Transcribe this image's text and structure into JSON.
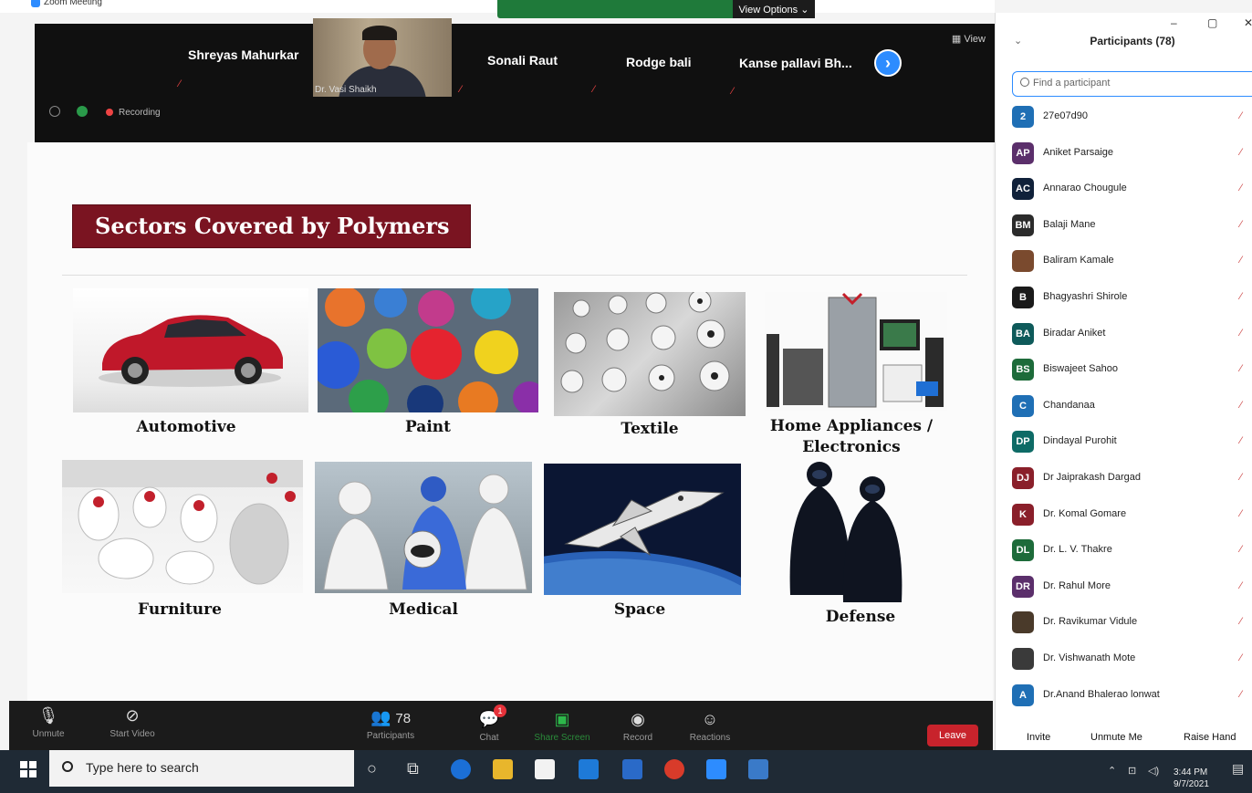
{
  "window": {
    "title": "Zoom Meeting"
  },
  "share_bar": {
    "view_options": "View Options ⌄"
  },
  "video_strip": {
    "participants": [
      "Shreyas Mahurkar",
      "Sonali Raut",
      "Rodge bali",
      "Kanse pallavi Bh..."
    ],
    "active_speaker": "Dr. Vasi Shaikh",
    "recording_label": "Recording",
    "view_label": "View",
    "next_arrow": "›"
  },
  "slide": {
    "title": "Sectors Covered by Polymers",
    "sectors": [
      {
        "label": "Automotive"
      },
      {
        "label": "Paint"
      },
      {
        "label": "Textile"
      },
      {
        "label_line1": "Home Appliances /",
        "label_line2": "Electronics"
      },
      {
        "label": "Furniture"
      },
      {
        "label": "Medical"
      },
      {
        "label": "Space"
      },
      {
        "label": "Defense"
      }
    ]
  },
  "panel": {
    "title": "Participants (78)",
    "collapse": "⌄",
    "search_placeholder": "Find a participant",
    "participants": [
      {
        "initials": "2",
        "name": "27e07d90",
        "color": "#1f6fb5"
      },
      {
        "initials": "AP",
        "name": "Aniket Parsaige",
        "color": "#5b2f6b"
      },
      {
        "initials": "AC",
        "name": "Annarao Chougule",
        "color": "#10213a"
      },
      {
        "initials": "BM",
        "name": "Balaji Mane",
        "color": "#2b2b2b"
      },
      {
        "initials": "",
        "name": "Baliram Kamale",
        "color": "#7a4a2e"
      },
      {
        "initials": "B",
        "name": "Bhagyashri Shirole",
        "color": "#1a1a1a"
      },
      {
        "initials": "BA",
        "name": "Biradar Aniket",
        "color": "#0e5a5a"
      },
      {
        "initials": "BS",
        "name": "Biswajeet Sahoo",
        "color": "#1d6b3a"
      },
      {
        "initials": "C",
        "name": "Chandanaa",
        "color": "#1f6fb5"
      },
      {
        "initials": "DP",
        "name": "Dindayal Purohit",
        "color": "#0e6b66"
      },
      {
        "initials": "DJ",
        "name": "Dr Jaiprakash Dargad",
        "color": "#8a1f2a"
      },
      {
        "initials": "K",
        "name": "Dr. Komal Gomare",
        "color": "#8a1f2a"
      },
      {
        "initials": "DL",
        "name": "Dr. L. V. Thakre",
        "color": "#1d6b3a"
      },
      {
        "initials": "DR",
        "name": "Dr. Rahul More",
        "color": "#5b2f6b"
      },
      {
        "initials": "",
        "name": "Dr. Ravikumar Vidule",
        "color": "#4a3a2a"
      },
      {
        "initials": "",
        "name": "Dr. Vishwanath Mote",
        "color": "#3a3a3a"
      },
      {
        "initials": "A",
        "name": "Dr.Anand Bhalerao lonwat",
        "color": "#1f6fb5"
      }
    ],
    "footer": {
      "invite": "Invite",
      "unmute": "Unmute Me",
      "raise_hand": "Raise Hand"
    }
  },
  "toolbar": {
    "unmute": "Unmute",
    "start_video": "Start Video",
    "participants": "Participants",
    "participants_count": "78",
    "chat": "Chat",
    "chat_badge": "1",
    "share_screen": "Share Screen",
    "record": "Record",
    "reactions": "Reactions",
    "leave": "Leave"
  },
  "taskbar": {
    "search_placeholder": "Type here to search",
    "time": "3:44 PM",
    "date": "9/7/2021"
  },
  "colors": {
    "zoom_blue": "#2d8cff",
    "slide_title_bg": "#7a1421",
    "leave_red": "#c8232c",
    "share_green": "#1f7a3a"
  }
}
